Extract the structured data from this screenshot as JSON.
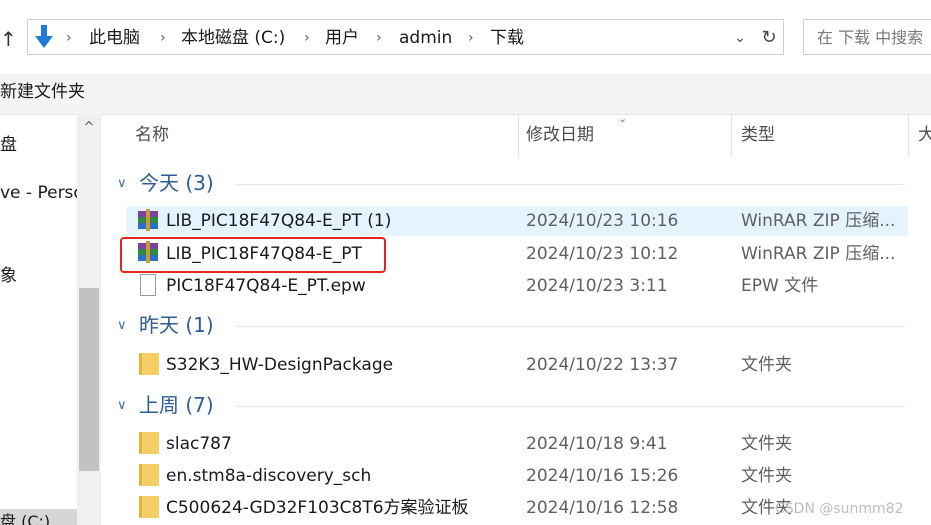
{
  "address_bar": {
    "breadcrumbs": [
      "此电脑",
      "本地磁盘 (C:)",
      "用户",
      "admin",
      "下载"
    ],
    "search_placeholder": "在 下载 中搜索"
  },
  "toolbar": {
    "new_folder_label": "新建文件夹"
  },
  "nav_pane": {
    "items": [
      "盘",
      "ve - Perso",
      "象",
      "盘 (C:)"
    ]
  },
  "columns": {
    "name": "名称",
    "modified": "修改日期",
    "type": "类型",
    "size": "大"
  },
  "groups": [
    {
      "label": "今天 (3)",
      "files": [
        {
          "name": "LIB_PIC18F47Q84-E_PT (1)",
          "modified": "2024/10/23 10:16",
          "type": "WinRAR ZIP 压缩...",
          "icon": "winrar-zip-icon",
          "selected": true
        },
        {
          "name": "LIB_PIC18F47Q84-E_PT",
          "modified": "2024/10/23 10:12",
          "type": "WinRAR ZIP 压缩...",
          "icon": "winrar-zip-icon",
          "highlighted": true
        },
        {
          "name": "PIC18F47Q84-E_PT.epw",
          "modified": "2024/10/23 3:11",
          "type": "EPW 文件",
          "icon": "file-icon"
        }
      ]
    },
    {
      "label": "昨天 (1)",
      "files": [
        {
          "name": "S32K3_HW-DesignPackage",
          "modified": "2024/10/22 13:37",
          "type": "文件夹",
          "icon": "folder-icon"
        }
      ]
    },
    {
      "label": "上周 (7)",
      "files": [
        {
          "name": "slac787",
          "modified": "2024/10/18 9:41",
          "type": "文件夹",
          "icon": "folder-icon"
        },
        {
          "name": "en.stm8a-discovery_sch",
          "modified": "2024/10/16 15:26",
          "type": "文件夹",
          "icon": "folder-icon"
        },
        {
          "name": "C500624-GD32F103C8T6方案验证板",
          "modified": "2024/10/16 12:58",
          "type": "文件夹",
          "icon": "folder-icon"
        }
      ]
    }
  ],
  "watermark": "CSDN @sunmm82",
  "colors": {
    "accent": "#2d5c96",
    "selection": "#e5f3ff",
    "highlight_border": "#e0261e",
    "folder": "#f5cf63"
  }
}
